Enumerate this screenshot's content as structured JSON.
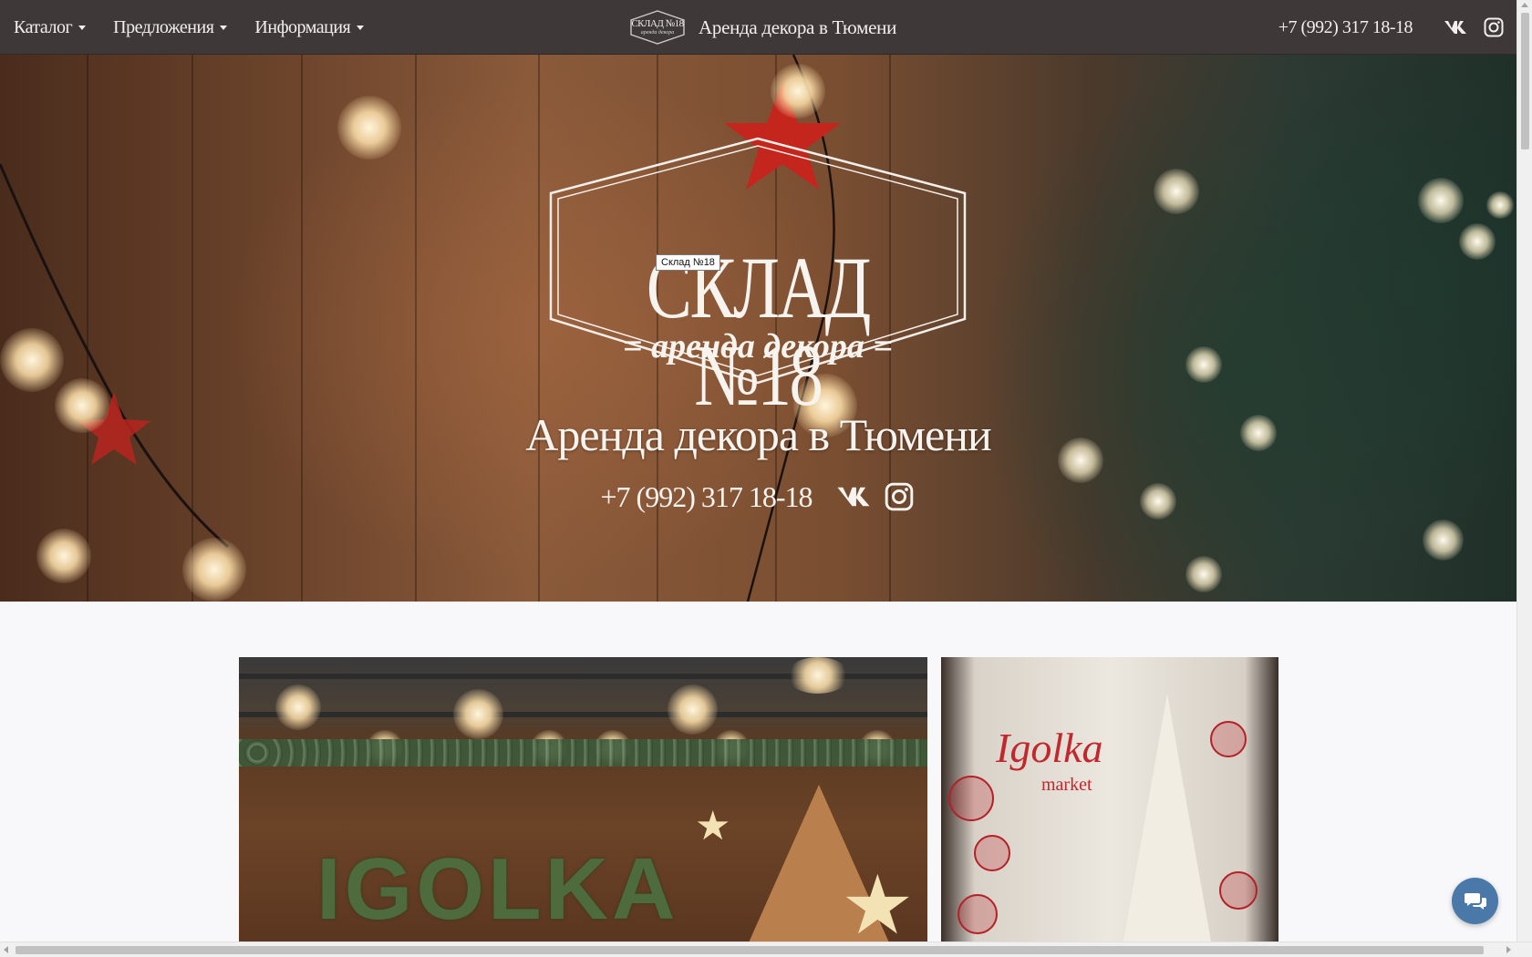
{
  "nav": {
    "menu": [
      {
        "label": "Каталог"
      },
      {
        "label": "Предложения"
      },
      {
        "label": "Информация"
      }
    ],
    "logo": {
      "title": "СКЛАД №18",
      "subtitle": "аренда декора"
    },
    "site_title": "Аренда декора в Тюмени",
    "phone": "+7 (992) 317 18-18",
    "icons": [
      "vk-icon",
      "instagram-icon"
    ]
  },
  "hero": {
    "logo_title": "СКЛАД №18",
    "logo_subtitle": "= аренда декора =",
    "tooltip": "Склад №18",
    "title": "Аренда декора в Тюмени",
    "phone": "+7 (992) 317 18-18",
    "icons": [
      "vk-icon",
      "instagram-icon"
    ]
  },
  "gallery": {
    "photo1_text": "IGOLKA",
    "photo2_sign": "Igolka",
    "photo2_sign_small": "market"
  },
  "chat": {
    "icon": "chat-icon",
    "color": "#4a78a8"
  },
  "colors": {
    "navbar": "#3e3838",
    "text_light": "#f3efef",
    "sign_red": "#c2272d"
  }
}
